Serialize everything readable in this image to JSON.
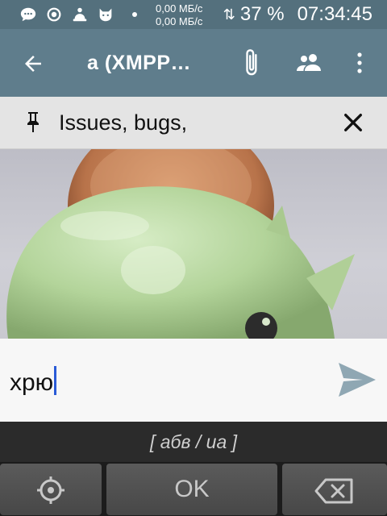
{
  "status_bar": {
    "net_up": "0,00 МБ/с",
    "net_down": "0,00 МБ/с",
    "arrows": "⇅",
    "battery": "37 %",
    "time": "07:34:45"
  },
  "app_bar": {
    "title": "a (XMPP…"
  },
  "pinned": {
    "text": "Issues, bugs,"
  },
  "composer": {
    "value": "хрю"
  },
  "keyboard": {
    "layout_hint": "[ абв / ua ]",
    "ok_label": "OK"
  },
  "colors": {
    "status_bar": "#54707d",
    "app_bar": "#5f7d8c",
    "send_icon": "#8fa7b3"
  }
}
